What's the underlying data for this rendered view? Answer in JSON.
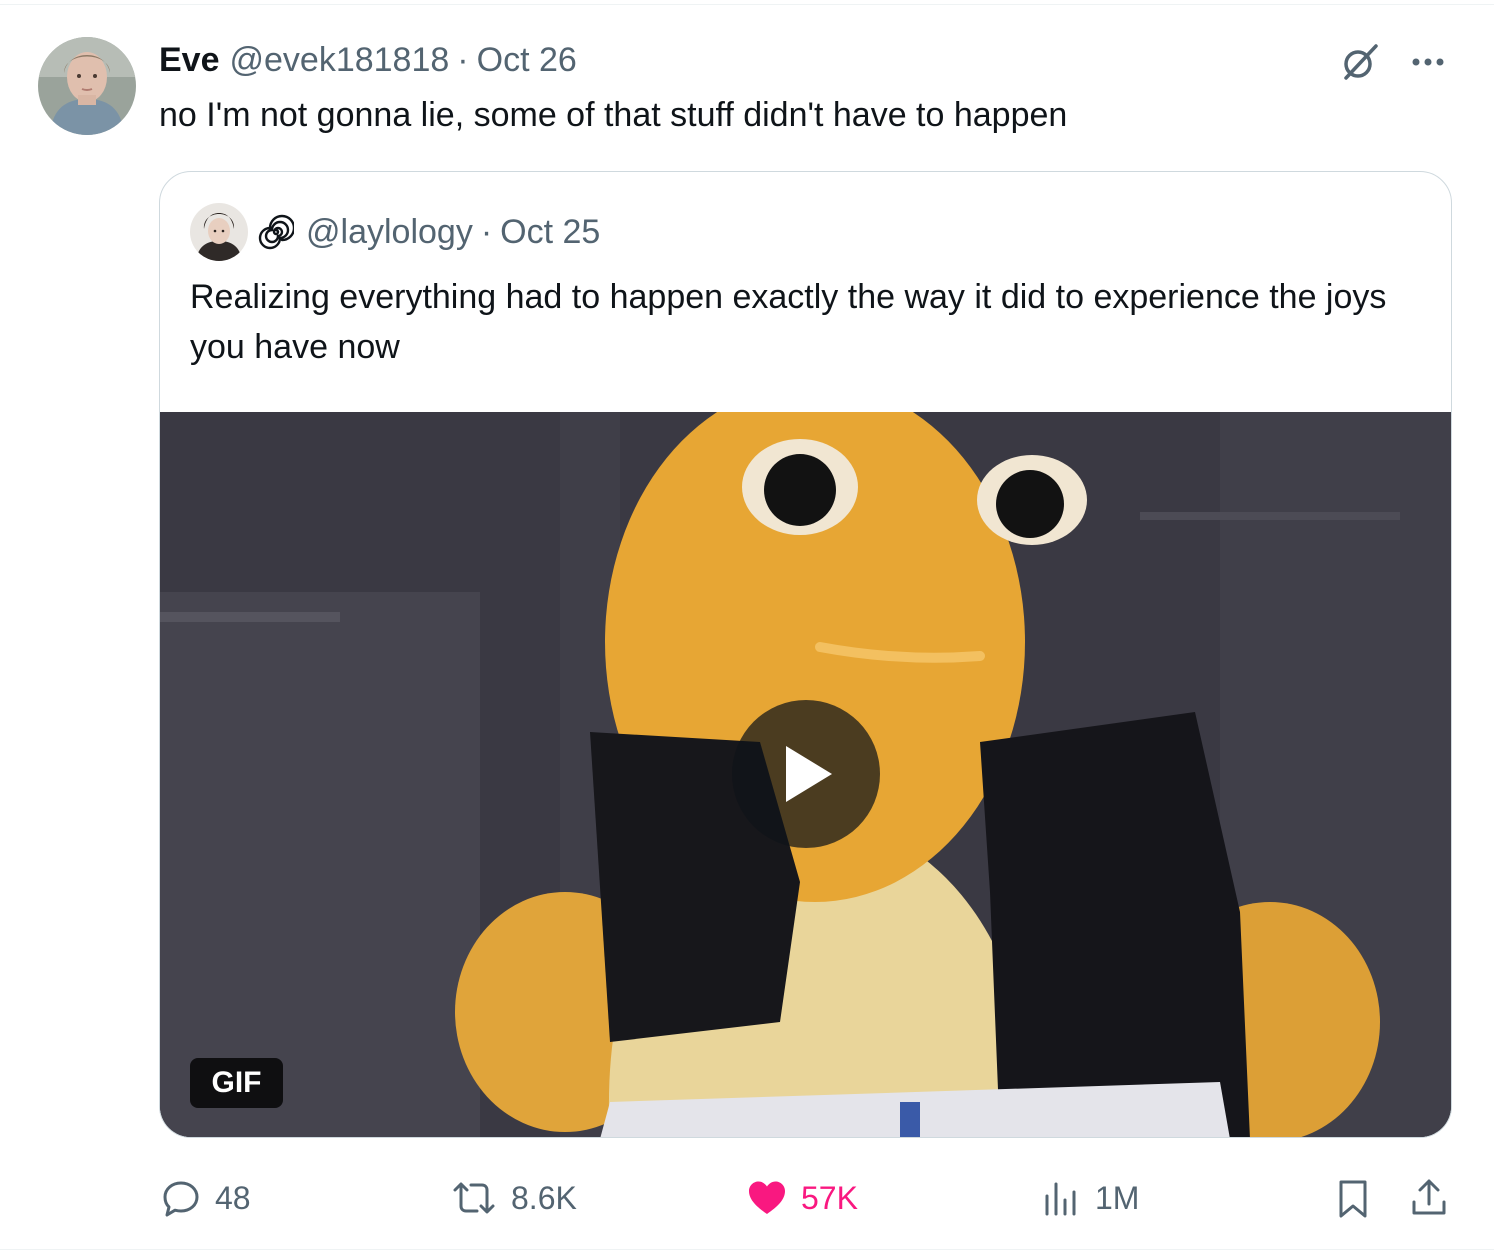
{
  "tweet": {
    "display_name": "Eve",
    "handle": "@evek181818",
    "separator": "·",
    "date": "Oct 26",
    "text": "no I'm not gonna lie, some of that stuff didn't have to happen"
  },
  "quoted_tweet": {
    "handle": "@laylology",
    "separator": "·",
    "date": "Oct 25",
    "text": "Realizing everything had to happen exactly the way it did to experience the joys you have now",
    "media_badge": "GIF"
  },
  "actions": {
    "replies": "48",
    "reposts": "8.6K",
    "likes": "57K",
    "views": "1M"
  },
  "icons": {
    "top_right": [
      "grok-icon",
      "more-icon"
    ],
    "action_bar": [
      "reply-icon",
      "repost-icon",
      "like-icon",
      "views-icon",
      "bookmark-icon",
      "share-icon"
    ]
  },
  "colors": {
    "text_primary": "#0f1419",
    "text_secondary": "#536471",
    "like_active": "#f91880",
    "border": "#cfd9de"
  }
}
